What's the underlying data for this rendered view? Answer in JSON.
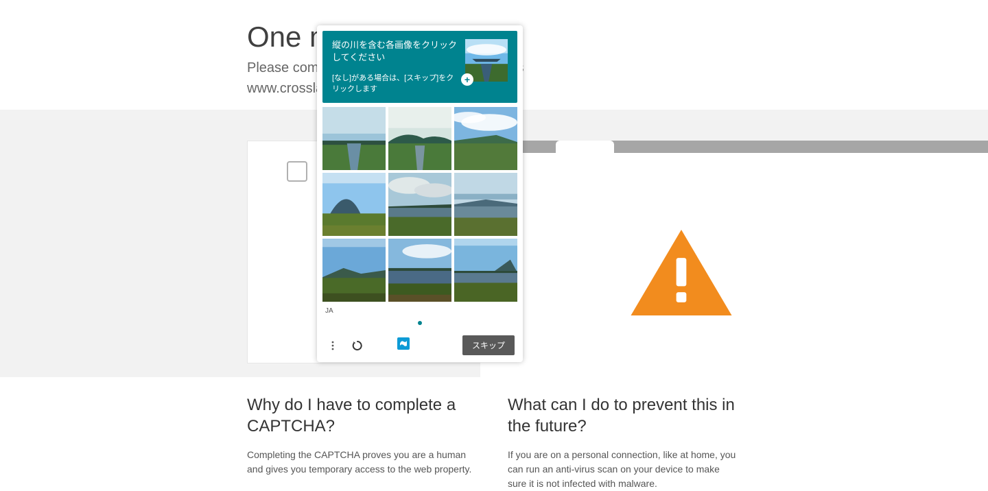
{
  "page": {
    "heading": "One more step",
    "subline1": "Please complete the security check to access",
    "subline2": "www.crosslandscaithness.gotdns.com"
  },
  "captcha": {
    "instruction": "縦の川を含む各画像をクリックしてください",
    "sub_instruction": "[なし]がある場合は、[スキップ]をクリックします",
    "lang_code": "JA",
    "skip_label": "スキップ",
    "tiles": [
      {
        "id": 0
      },
      {
        "id": 1
      },
      {
        "id": 2
      },
      {
        "id": 3
      },
      {
        "id": 4
      },
      {
        "id": 5
      },
      {
        "id": 6
      },
      {
        "id": 7
      },
      {
        "id": 8
      }
    ]
  },
  "faq": {
    "left_heading": "Why do I have to complete a CAPTCHA?",
    "left_text": "Completing the CAPTCHA proves you are a human and gives you temporary access to the web property.",
    "right_heading": "What can I do to prevent this in the future?",
    "right_text": "If you are on a personal connection, like at home, you can run an anti-virus scan on your device to make sure it is not infected with malware."
  },
  "colors": {
    "accent": "#00838f",
    "warning": "#f28c1e"
  }
}
